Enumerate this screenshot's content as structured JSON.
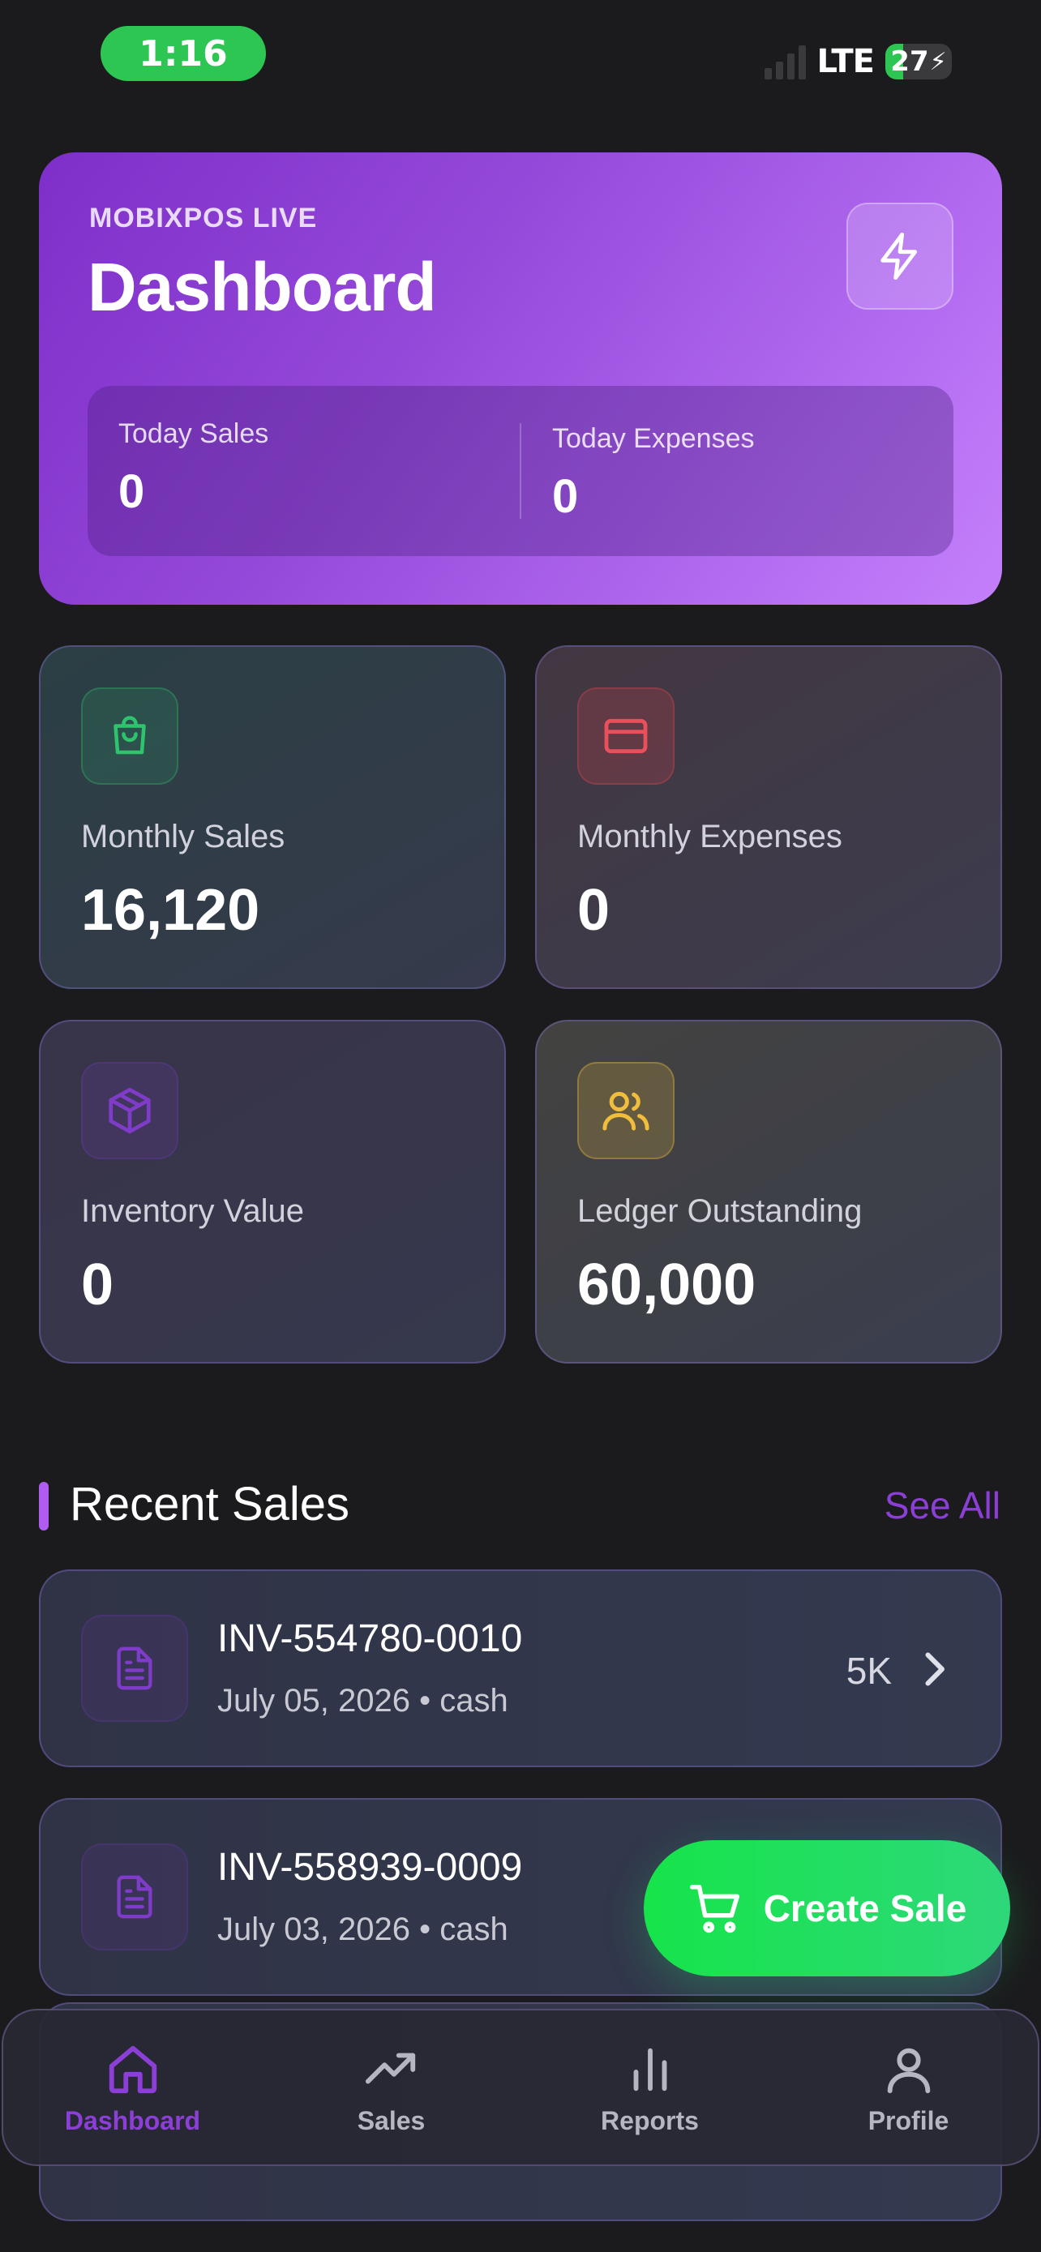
{
  "status_bar": {
    "time": "1:16",
    "network": "LTE",
    "battery": "27",
    "battery_level": 0.27
  },
  "hero": {
    "eyebrow": "MOBIXPOS LIVE",
    "title": "Dashboard",
    "today_sales_label": "Today Sales",
    "today_sales_value": "0",
    "today_expenses_label": "Today Expenses",
    "today_expenses_value": "0"
  },
  "stats": {
    "monthly_sales": {
      "label": "Monthly Sales",
      "value": "16,120",
      "color": "#2ec46e"
    },
    "monthly_expenses": {
      "label": "Monthly Expenses",
      "value": "0",
      "color": "#e8505b"
    },
    "inventory_value": {
      "label": "Inventory Value",
      "value": "0",
      "color": "#7e3cc8"
    },
    "ledger_outstanding": {
      "label": "Ledger Outstanding",
      "value": "60,000",
      "color": "#f0be3c"
    }
  },
  "recent_sales": {
    "title": "Recent Sales",
    "see_all": "See All",
    "items": [
      {
        "id": "INV-554780-0010",
        "date": "July 05, 2026",
        "method": "cash",
        "amount": "5K"
      },
      {
        "id": "INV-558939-0009",
        "date": "July 03, 2026",
        "method": "cash",
        "amount": ""
      }
    ]
  },
  "fab": {
    "label": "Create Sale"
  },
  "nav": {
    "items": [
      {
        "label": "Dashboard",
        "icon": "home-icon",
        "active": true
      },
      {
        "label": "Sales",
        "icon": "trending-up-icon",
        "active": false
      },
      {
        "label": "Reports",
        "icon": "bar-chart-icon",
        "active": false
      },
      {
        "label": "Profile",
        "icon": "user-icon",
        "active": false
      }
    ]
  },
  "colors": {
    "accent": "#8c3fd6",
    "fab_green": "#16e44a",
    "background": "#1b1b1d"
  }
}
